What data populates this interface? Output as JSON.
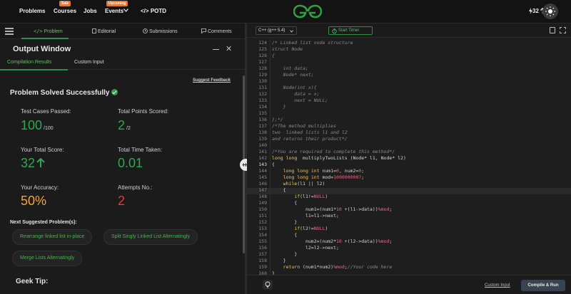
{
  "topnav": {
    "items": [
      "Problems",
      "Courses",
      "Jobs",
      "Events",
      "POTD"
    ],
    "courses_badge": "Sale",
    "events_badge": "Upcoming",
    "potd_prefix": "</>",
    "streak": "32"
  },
  "tabs": {
    "problem": "Problem",
    "editorial": "Editorial",
    "submissions": "Submissions",
    "comments": "Comments"
  },
  "output_window": {
    "title": "Output Window",
    "subtabs": [
      "Compilation Results",
      "Custom Input"
    ],
    "suggest_feedback": "Suggest Feedback",
    "status": "Problem Solved Successfully",
    "stats": {
      "test_cases_label": "Test Cases Passed:",
      "test_cases_value": "100",
      "test_cases_total": "/100",
      "points_label": "Total Points Scored:",
      "points_value": "2",
      "points_total": "/2",
      "score_label": "Your Total Score:",
      "score_value": "32",
      "time_label": "Total Time Taken:",
      "time_value": "0.01",
      "accuracy_label": "Your Accuracy:",
      "accuracy_value": "50%",
      "attempts_label": "Attempts No.:",
      "attempts_value": "2"
    },
    "next_title": "Next Suggested Problem(s):",
    "suggestions": [
      "Rearrange linked list in-place",
      "Split Singly Linked List Alternatingly",
      "Merge Lists Alternatingly"
    ],
    "geek_tip": "Geek Tip:"
  },
  "editor": {
    "language": "C++ (g++ 5.4)",
    "timer_label": "Start Timer",
    "custom_input": "Custom Input",
    "compile_run": "Compile & Run",
    "current_line": 143,
    "lines": [
      {
        "n": "124",
        "t": "/* Linked list node structure",
        "c": "com"
      },
      {
        "n": "125",
        "t": "struct Node",
        "c": "com"
      },
      {
        "n": "126",
        "t": "{",
        "c": "com"
      },
      {
        "n": "127",
        "t": "",
        "c": "com"
      },
      {
        "n": "128",
        "t": "    int data;",
        "c": "com"
      },
      {
        "n": "129",
        "t": "    Node* next;",
        "c": "com"
      },
      {
        "n": "130",
        "t": "",
        "c": "com"
      },
      {
        "n": "131",
        "t": "    Node(int x){",
        "c": "com"
      },
      {
        "n": "132",
        "t": "        data = x;",
        "c": "com"
      },
      {
        "n": "133",
        "t": "        next = NULL;",
        "c": "com"
      },
      {
        "n": "134",
        "t": "    }",
        "c": "com"
      },
      {
        "n": "135",
        "t": "",
        "c": "com"
      },
      {
        "n": "136",
        "t": "};*/",
        "c": "com"
      },
      {
        "n": "137",
        "t": "/*The method multiplies",
        "c": "com"
      },
      {
        "n": "138",
        "t": "two  linked lists l1 and l2",
        "c": "com"
      },
      {
        "n": "139",
        "t": "and returns their product*/",
        "c": "com"
      },
      {
        "n": "140",
        "t": "",
        "c": "com"
      },
      {
        "n": "141",
        "t": "/*You are required to complete this method*/",
        "c": "com"
      },
      {
        "n": "142",
        "t": "long long  multiplyTwoLists (Node* l1, Node* l2)",
        "c": "sig"
      },
      {
        "n": "143",
        "t": "{",
        "c": "plain"
      },
      {
        "n": "144",
        "t": "    long long int num1=0, num2=0;",
        "c": "decl1"
      },
      {
        "n": "145",
        "t": "    long long int mod=1000000007;",
        "c": "decl2"
      },
      {
        "n": "146",
        "t": "    while(l1 || l2)",
        "c": "while"
      },
      {
        "n": "147",
        "t": "    {",
        "c": "plain"
      },
      {
        "n": "148",
        "t": "        if(l1!=NULL)",
        "c": "if1"
      },
      {
        "n": "149",
        "t": "        {",
        "c": "plain"
      },
      {
        "n": "150",
        "t": "            num1=(num1*10 +(l1->data))%mod;",
        "c": "calc1"
      },
      {
        "n": "151",
        "t": "            l1=l1->next;",
        "c": "plain"
      },
      {
        "n": "152",
        "t": "        }",
        "c": "plain"
      },
      {
        "n": "153",
        "t": "        if(l2!=NULL)",
        "c": "if2"
      },
      {
        "n": "154",
        "t": "        {",
        "c": "plain"
      },
      {
        "n": "155",
        "t": "            num2=(num2*10 +(l2->data))%mod;",
        "c": "calc2"
      },
      {
        "n": "156",
        "t": "            l2=l2->next;",
        "c": "plain"
      },
      {
        "n": "157",
        "t": "        }",
        "c": "plain"
      },
      {
        "n": "158",
        "t": "    }",
        "c": "plain"
      },
      {
        "n": "159",
        "t": "    return (num1*num2)%mod;//Your code here",
        "c": "ret"
      },
      {
        "n": "160",
        "t": "}",
        "c": "plain"
      }
    ]
  }
}
